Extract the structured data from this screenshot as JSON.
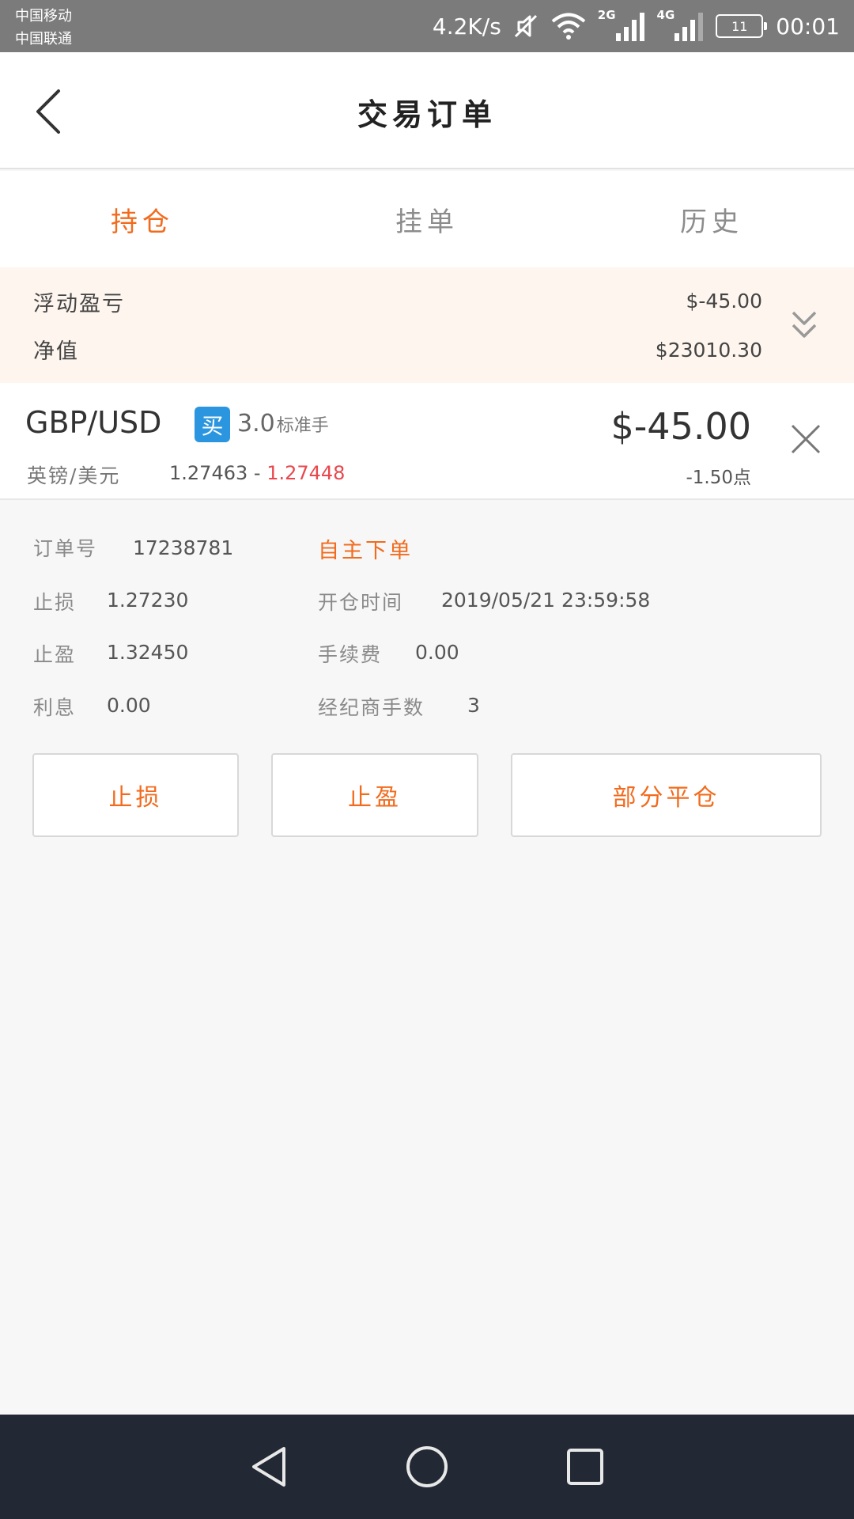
{
  "status_bar": {
    "carrier_1": "中国移动",
    "carrier_2": "中国联通",
    "net_speed": "4.2K/s",
    "net_label_1": "2G",
    "net_label_2": "4G",
    "battery": "11",
    "time": "00:01"
  },
  "header": {
    "title": "交易订单"
  },
  "tabs": [
    {
      "label": "持仓",
      "active": true
    },
    {
      "label": "挂单",
      "active": false
    },
    {
      "label": "历史",
      "active": false
    }
  ],
  "summary": {
    "floating_pnl_label": "浮动盈亏",
    "floating_pnl_value": "$-45.00",
    "equity_label": "净值",
    "equity_value": "$23010.30"
  },
  "position": {
    "symbol": "GBP/USD",
    "side_badge": "买",
    "lots": "3.0",
    "lots_unit": "标准手",
    "symbol_cn": "英镑/美元",
    "open_price": "1.27463",
    "price_separator": "-",
    "current_price": "1.27448",
    "pnl": "$-45.00",
    "points": "-1.50点"
  },
  "details": {
    "order_no_label": "订单号",
    "order_no_value": "17238781",
    "order_type": "自主下单",
    "stop_loss_label": "止损",
    "stop_loss_value": "1.27230",
    "open_time_label": "开仓时间",
    "open_time_value": "2019/05/21 23:59:58",
    "take_profit_label": "止盈",
    "take_profit_value": "1.32450",
    "fee_label": "手续费",
    "fee_value": "0.00",
    "interest_label": "利息",
    "interest_value": "0.00",
    "broker_lots_label": "经纪商手数",
    "broker_lots_value": "3"
  },
  "actions": {
    "stop_loss": "止损",
    "take_profit": "止盈",
    "partial_close": "部分平仓"
  },
  "colors": {
    "accent": "#f26b1d",
    "badge": "#2b96df",
    "loss_red": "#e9474d",
    "nav_bar": "#222834"
  }
}
